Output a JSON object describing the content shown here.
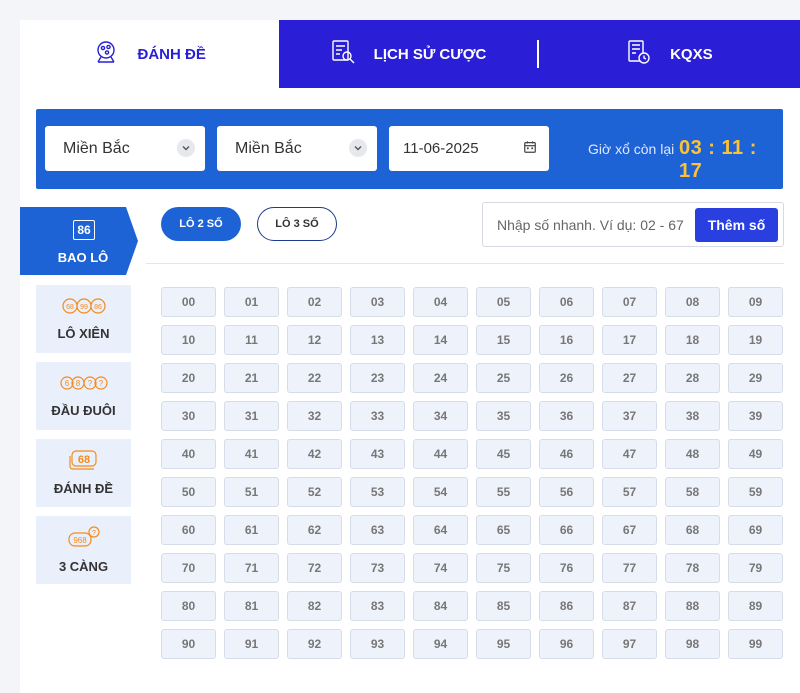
{
  "tabs": [
    {
      "label": "ĐÁNH ĐỀ",
      "icon": "lottery-balls-icon",
      "active": true
    },
    {
      "label": "LỊCH SỬ CƯỢC",
      "icon": "history-search-icon",
      "active": false
    },
    {
      "label": "KQXS",
      "icon": "results-clock-icon",
      "active": false
    }
  ],
  "filters": {
    "region1": "Miền Bắc",
    "region2": "Miền Bắc",
    "date": "11-06-2025",
    "countdown_label": "Giờ xổ còn lại",
    "countdown": "03 : 11 : 17"
  },
  "sidebar": {
    "items": [
      {
        "label": "BAO LÔ",
        "icon": "86-box-icon",
        "icon_text": "86",
        "active": true
      },
      {
        "label": "LÔ XIÊN",
        "icon": "three-balls-icon",
        "icon_text": "68 99 86",
        "active": false
      },
      {
        "label": "ĐẦU ĐUÔI",
        "icon": "head-tail-balls-icon",
        "icon_text": "6 8 ? ?",
        "active": false
      },
      {
        "label": "ĐÁNH ĐỀ",
        "icon": "stacked-68-icon",
        "icon_text": "68",
        "active": false
      },
      {
        "label": "3 CÀNG",
        "icon": "968-icon",
        "icon_text": "968",
        "active": false
      }
    ]
  },
  "modes": {
    "two_digit": "LÔ 2 SỐ",
    "three_digit": "LÔ 3 SỐ",
    "active": "two_digit"
  },
  "quick_input": {
    "placeholder": "Nhập số nhanh. Ví dụ: 02 - 67",
    "button": "Thêm số"
  },
  "numbers": [
    "00",
    "01",
    "02",
    "03",
    "04",
    "05",
    "06",
    "07",
    "08",
    "09",
    "10",
    "11",
    "12",
    "13",
    "14",
    "15",
    "16",
    "17",
    "18",
    "19",
    "20",
    "21",
    "22",
    "23",
    "24",
    "25",
    "26",
    "27",
    "28",
    "29",
    "30",
    "31",
    "32",
    "33",
    "34",
    "35",
    "36",
    "37",
    "38",
    "39",
    "40",
    "41",
    "42",
    "43",
    "44",
    "45",
    "46",
    "47",
    "48",
    "49",
    "50",
    "51",
    "52",
    "53",
    "54",
    "55",
    "56",
    "57",
    "58",
    "59",
    "60",
    "61",
    "62",
    "63",
    "64",
    "65",
    "66",
    "67",
    "68",
    "69",
    "70",
    "71",
    "72",
    "73",
    "74",
    "75",
    "76",
    "77",
    "78",
    "79",
    "80",
    "81",
    "82",
    "83",
    "84",
    "85",
    "86",
    "87",
    "88",
    "89",
    "90",
    "91",
    "92",
    "93",
    "94",
    "95",
    "96",
    "97",
    "98",
    "99"
  ],
  "colors": {
    "primary_tab": "#2a1fd6",
    "filter_bar": "#1e63d6",
    "countdown": "#ffc233",
    "accent_orange": "#f28b1e"
  }
}
